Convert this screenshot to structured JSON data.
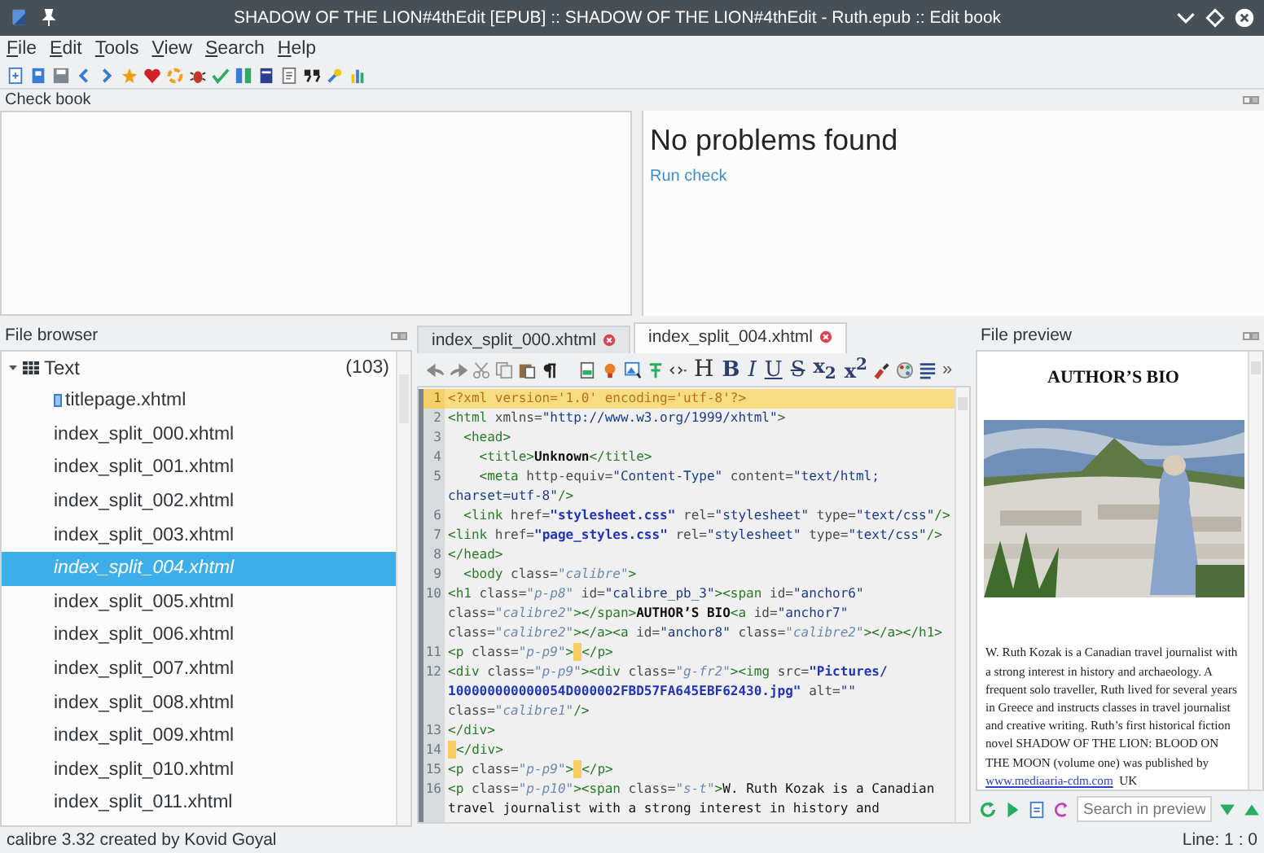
{
  "window": {
    "title": "SHADOW OF THE LION#4thEdit [EPUB] :: SHADOW OF THE LION#4thEdit - Ruth.epub :: Edit book"
  },
  "menu": [
    "File",
    "Edit",
    "Tools",
    "View",
    "Search",
    "Help"
  ],
  "check_book": {
    "title": "Check book",
    "message": "No problems found",
    "link": "Run check"
  },
  "file_browser": {
    "title": "File browser",
    "folder": {
      "name": "Text",
      "count": "(103)",
      "expanded": true,
      "children": [
        {
          "name": "titlepage.xhtml",
          "kind": "cover",
          "selected": false
        },
        {
          "name": "index_split_000.xhtml",
          "kind": "file",
          "selected": false
        },
        {
          "name": "index_split_001.xhtml",
          "kind": "file",
          "selected": false
        },
        {
          "name": "index_split_002.xhtml",
          "kind": "file",
          "selected": false
        },
        {
          "name": "index_split_003.xhtml",
          "kind": "file",
          "selected": false
        },
        {
          "name": "index_split_004.xhtml",
          "kind": "file",
          "selected": true
        },
        {
          "name": "index_split_005.xhtml",
          "kind": "file",
          "selected": false
        },
        {
          "name": "index_split_006.xhtml",
          "kind": "file",
          "selected": false
        },
        {
          "name": "index_split_007.xhtml",
          "kind": "file",
          "selected": false
        },
        {
          "name": "index_split_008.xhtml",
          "kind": "file",
          "selected": false
        },
        {
          "name": "index_split_009.xhtml",
          "kind": "file",
          "selected": false
        },
        {
          "name": "index_split_010.xhtml",
          "kind": "file",
          "selected": false
        },
        {
          "name": "index_split_011.xhtml",
          "kind": "file",
          "selected": false
        }
      ]
    }
  },
  "editor": {
    "tabs": [
      {
        "label": "index_split_000.xhtml",
        "selected": false
      },
      {
        "label": "index_split_004.xhtml",
        "selected": true
      }
    ],
    "format_buttons": [
      {
        "label": "H",
        "kind": "heading"
      },
      {
        "label": "B",
        "kind": "bold"
      },
      {
        "label": "I",
        "kind": "italic"
      },
      {
        "label": "U",
        "kind": "underline"
      },
      {
        "label": "S",
        "kind": "strike"
      },
      {
        "label": "x$_{2}$",
        "kind": "sub"
      },
      {
        "label": "x$^{2}$",
        "kind": "sup"
      }
    ],
    "overflow": "»",
    "lines": [
      {
        "number": "1",
        "current": true,
        "rows": [
          {
            "parts": [
              {
                "kind": "pi",
                "text": "<?xml version='1.0' encoding='utf-8'?>"
              }
            ]
          }
        ]
      },
      {
        "number": "2",
        "current": false,
        "rows": [
          {
            "parts": [
              {
                "kind": "tag",
                "text": "<html"
              },
              {
                "kind": "attr",
                "text": " xmlns="
              },
              {
                "kind": "str",
                "text": "\"http://www.w3.org/1999/xhtml\""
              },
              {
                "kind": "tag",
                "text": ">"
              }
            ]
          }
        ]
      },
      {
        "number": "3",
        "current": false,
        "rows": [
          {
            "parts": [
              {
                "kind": "tag",
                "text": "  <head>"
              }
            ]
          }
        ]
      },
      {
        "number": "4",
        "current": false,
        "rows": [
          {
            "parts": [
              {
                "kind": "tag",
                "text": "    <title>"
              },
              {
                "kind": "text",
                "text": "Unknown"
              },
              {
                "kind": "tag",
                "text": "</title>"
              }
            ]
          }
        ]
      },
      {
        "number": "5",
        "current": false,
        "rows": [
          {
            "parts": [
              {
                "kind": "tag",
                "text": "    <meta"
              },
              {
                "kind": "attr",
                "text": " http-equiv="
              },
              {
                "kind": "str",
                "text": "\"Content-Type\""
              },
              {
                "kind": "attr",
                "text": " content="
              },
              {
                "kind": "str",
                "text": "\"text/html;"
              }
            ]
          },
          {
            "parts": [
              {
                "kind": "str",
                "text": "charset=utf-8\""
              },
              {
                "kind": "tag",
                "text": "/>"
              }
            ]
          }
        ]
      },
      {
        "number": "6",
        "current": false,
        "rows": [
          {
            "parts": [
              {
                "kind": "tag",
                "text": "  <link"
              },
              {
                "kind": "attr",
                "text": " href="
              },
              {
                "kind": "link",
                "text": "\"stylesheet.css\""
              },
              {
                "kind": "attr",
                "text": " rel="
              },
              {
                "kind": "str",
                "text": "\"stylesheet\""
              },
              {
                "kind": "attr",
                "text": " type="
              },
              {
                "kind": "str",
                "text": "\"text/css\""
              },
              {
                "kind": "tag",
                "text": "/>"
              }
            ]
          }
        ]
      },
      {
        "number": "7",
        "current": false,
        "rows": [
          {
            "parts": [
              {
                "kind": "tag",
                "text": "<link"
              },
              {
                "kind": "attr",
                "text": " href="
              },
              {
                "kind": "link",
                "text": "\"page_styles.css\""
              },
              {
                "kind": "attr",
                "text": " rel="
              },
              {
                "kind": "str",
                "text": "\"stylesheet\""
              },
              {
                "kind": "attr",
                "text": " type="
              },
              {
                "kind": "str",
                "text": "\"text/css\""
              },
              {
                "kind": "tag",
                "text": "/>"
              }
            ]
          }
        ]
      },
      {
        "number": "8",
        "current": false,
        "rows": [
          {
            "parts": [
              {
                "kind": "tag",
                "text": "</head>"
              }
            ]
          }
        ]
      },
      {
        "number": "9",
        "current": false,
        "rows": [
          {
            "parts": [
              {
                "kind": "tag",
                "text": "  <body"
              },
              {
                "kind": "attr",
                "text": " class="
              },
              {
                "kind": "cls",
                "text": "\"calibre\""
              },
              {
                "kind": "tag",
                "text": ">"
              }
            ]
          }
        ]
      },
      {
        "number": "10",
        "current": false,
        "rows": [
          {
            "parts": [
              {
                "kind": "tag",
                "text": "<h1"
              },
              {
                "kind": "attr",
                "text": " class="
              },
              {
                "kind": "cls",
                "text": "\"p-p8\""
              },
              {
                "kind": "attr",
                "text": " id="
              },
              {
                "kind": "str",
                "text": "\"calibre_pb_3\""
              },
              {
                "kind": "tag",
                "text": "><span"
              },
              {
                "kind": "attr",
                "text": " id="
              },
              {
                "kind": "str",
                "text": "\"anchor6\""
              }
            ]
          },
          {
            "parts": [
              {
                "kind": "attr",
                "text": "class="
              },
              {
                "kind": "cls",
                "text": "\"calibre2\""
              },
              {
                "kind": "tag",
                "text": "></span>"
              },
              {
                "kind": "text",
                "text": "AUTHOR’S BIO"
              },
              {
                "kind": "tag",
                "text": "<a"
              },
              {
                "kind": "attr",
                "text": " id="
              },
              {
                "kind": "str",
                "text": "\"anchor7\""
              }
            ]
          },
          {
            "parts": [
              {
                "kind": "attr",
                "text": "class="
              },
              {
                "kind": "cls",
                "text": "\"calibre2\""
              },
              {
                "kind": "tag",
                "text": "></a><a"
              },
              {
                "kind": "attr",
                "text": " id="
              },
              {
                "kind": "str",
                "text": "\"anchor8\""
              },
              {
                "kind": "attr",
                "text": " class="
              },
              {
                "kind": "cls",
                "text": "\"calibre2\""
              },
              {
                "kind": "tag",
                "text": "></a></h1>"
              }
            ]
          }
        ]
      },
      {
        "number": "11",
        "current": false,
        "rows": [
          {
            "parts": [
              {
                "kind": "tag",
                "text": "<p"
              },
              {
                "kind": "attr",
                "text": " class="
              },
              {
                "kind": "cls",
                "text": "\"p-p9\""
              },
              {
                "kind": "tag",
                "text": ">"
              },
              {
                "kind": "nbsp"
              },
              {
                "kind": "tag",
                "text": "</p>"
              }
            ]
          }
        ]
      },
      {
        "number": "12",
        "current": false,
        "rows": [
          {
            "parts": [
              {
                "kind": "tag",
                "text": "<div"
              },
              {
                "kind": "attr",
                "text": " class="
              },
              {
                "kind": "cls",
                "text": "\"p-p9\""
              },
              {
                "kind": "tag",
                "text": "><div"
              },
              {
                "kind": "attr",
                "text": " class="
              },
              {
                "kind": "cls",
                "text": "\"g-fr2\""
              },
              {
                "kind": "tag",
                "text": "><img"
              },
              {
                "kind": "attr",
                "text": " src="
              },
              {
                "kind": "link",
                "text": "\"Pictures/"
              }
            ]
          },
          {
            "parts": [
              {
                "kind": "link",
                "text": "100000000000054D000002FBD57FA645EBF62430.jpg\""
              },
              {
                "kind": "attr",
                "text": " alt="
              },
              {
                "kind": "str",
                "text": "\"\""
              }
            ]
          },
          {
            "parts": [
              {
                "kind": "attr",
                "text": "class="
              },
              {
                "kind": "cls",
                "text": "\"calibre1\""
              },
              {
                "kind": "tag",
                "text": "/>"
              }
            ]
          }
        ]
      },
      {
        "number": "13",
        "current": false,
        "rows": [
          {
            "parts": [
              {
                "kind": "tag",
                "text": "</div>"
              }
            ]
          }
        ]
      },
      {
        "number": "14",
        "current": false,
        "rows": [
          {
            "parts": [
              {
                "kind": "nbsp"
              },
              {
                "kind": "tag",
                "text": "</div>"
              }
            ]
          }
        ]
      },
      {
        "number": "15",
        "current": false,
        "rows": [
          {
            "parts": [
              {
                "kind": "tag",
                "text": "<p"
              },
              {
                "kind": "attr",
                "text": " class="
              },
              {
                "kind": "cls",
                "text": "\"p-p9\""
              },
              {
                "kind": "tag",
                "text": ">"
              },
              {
                "kind": "nbsp"
              },
              {
                "kind": "tag",
                "text": "</p>"
              }
            ]
          }
        ]
      },
      {
        "number": "16",
        "current": false,
        "rows": [
          {
            "parts": [
              {
                "kind": "tag",
                "text": "<p"
              },
              {
                "kind": "attr",
                "text": " class="
              },
              {
                "kind": "cls",
                "text": "\"p-p10\""
              },
              {
                "kind": "tag",
                "text": "><span"
              },
              {
                "kind": "attr",
                "text": " class="
              },
              {
                "kind": "cls",
                "text": "\"s-t\""
              },
              {
                "kind": "tag",
                "text": ">"
              },
              {
                "kind": "plain",
                "text": "W. Ruth Kozak is a Canadian"
              }
            ]
          },
          {
            "parts": [
              {
                "kind": "plain",
                "text": "travel journalist with a strong interest in history and"
              }
            ]
          }
        ]
      }
    ]
  },
  "preview": {
    "title": "File preview",
    "heading": "AUTHOR’S BIO",
    "bio_text": "W. Ruth Kozak is a Canadian travel journalist with a strong interest in history and archaeology. A frequent solo traveller, Ruth lived for several years in Greece and instructs classes in travel journalist and creative writing. Ruth’s first historical fiction novel SHADOW OF THE LION: BLOOD ON THE MOON (volume one) was published by",
    "bio_link": "www.mediaaria-cdm.com",
    "bio_tail": "UK",
    "search": {
      "placeholder": "Search in preview"
    }
  },
  "status_bar": {
    "left": "calibre 3.32 created by Kovid Goyal",
    "right": "Line: 1 : 0"
  }
}
